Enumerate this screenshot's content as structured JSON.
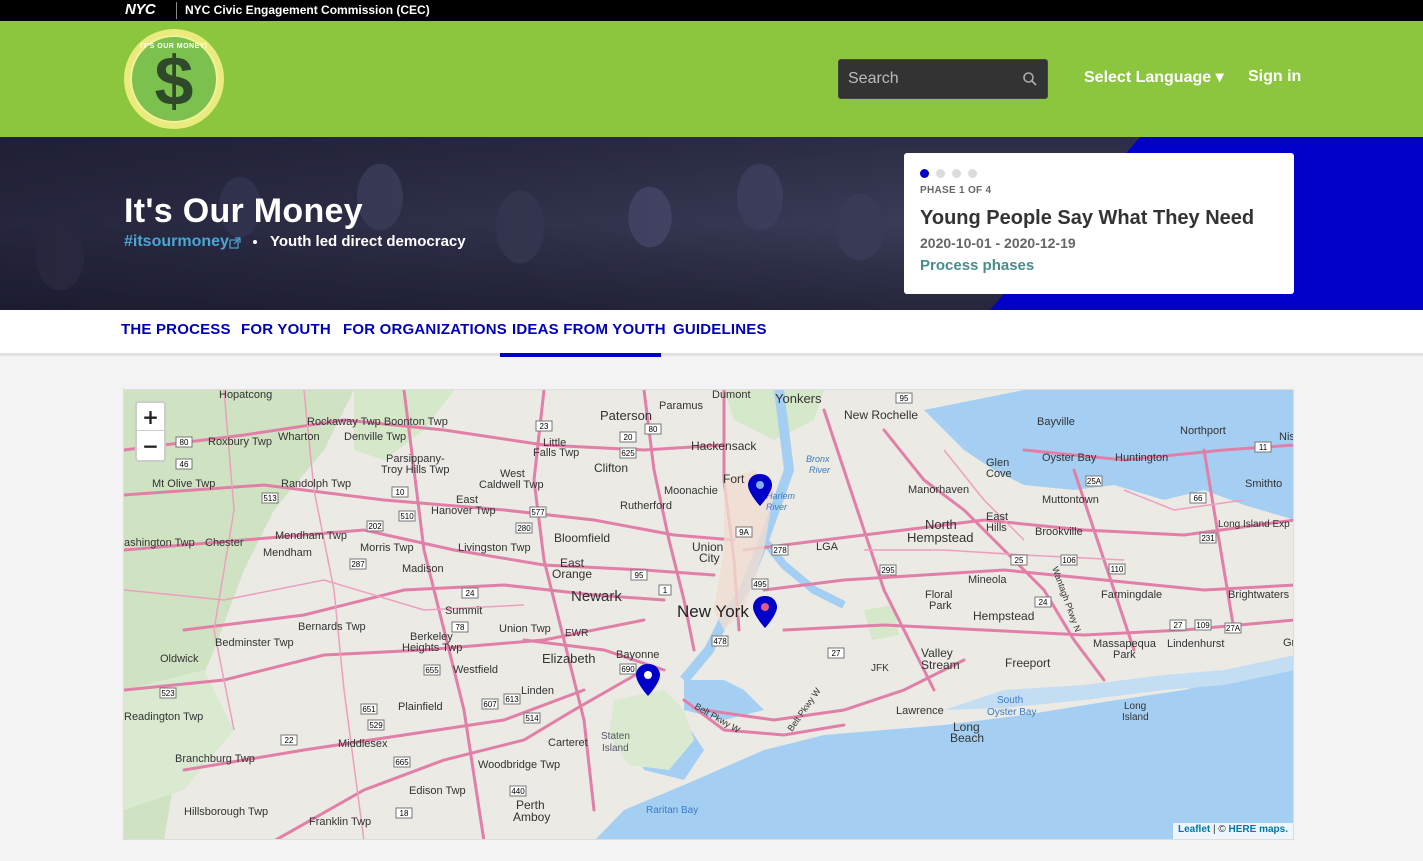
{
  "nyc_bar": {
    "logo_text": "NYC",
    "agency": "NYC Civic Engagement Commission (CEC)"
  },
  "header": {
    "logo_ring_text": "IT'S OUR MONEY!",
    "logo_symbol": "$",
    "search_placeholder": "Search",
    "language_label": "Select Language ▾",
    "signin_label": "Sign in"
  },
  "hero": {
    "title": "It's Our Money",
    "handle": "#itsourmoney",
    "slogan": "Youth led direct democracy",
    "phase": {
      "label": "PHASE 1 OF 4",
      "name": "Young People Say What They Need",
      "dates": "2020-10-01 - 2020-12-19",
      "link": "Process phases",
      "total": 4,
      "current": 1
    }
  },
  "nav": {
    "tabs": [
      {
        "label": "THE PROCESS"
      },
      {
        "label": "FOR YOUTH"
      },
      {
        "label": "FOR ORGANIZATIONS"
      },
      {
        "label": "IDEAS FROM YOUTH",
        "active": true
      },
      {
        "label": "GUIDELINES"
      }
    ]
  },
  "map": {
    "zoom_in": "+",
    "zoom_out": "−",
    "attribution_leaflet": "Leaflet",
    "attribution_sep": " | © ",
    "attribution_provider": "HERE maps.",
    "marker_count": 3,
    "labels": {
      "hopatcong": "Hopatcong",
      "rockaway": "Rockaway Twp Boonton Twp",
      "roxbury": "Roxbury Twp",
      "wharton": "Wharton",
      "denville": "Denville Twp",
      "parsippany": "Parsippany-",
      "troyhills": "Troy Hills Twp",
      "mtolive": "Mt Olive Twp",
      "randolph": "Randolph Twp",
      "eastHanover": "East",
      "eastHanover2": "Hanover Twp",
      "westCaldwell": "West",
      "westCaldwell2": "Caldwell Twp",
      "paterson": "Paterson",
      "littleFalls": "Little",
      "littleFalls2": "Falls Twp",
      "clifton": "Clifton",
      "paramus": "Paramus",
      "dumont": "Dumont",
      "hackensack": "Hackensack",
      "yonkers": "Yonkers",
      "newRochelle": "New Rochelle",
      "bayville": "Bayville",
      "northport": "Northport",
      "oysterBay": "Oyster Bay",
      "huntington": "Huntington",
      "glenCove": "Glen",
      "glenCove2": "Cove",
      "smithtown": "Smithto",
      "manorhaven": "Manorhaven",
      "muttontown": "Muttontown",
      "fort": "Fort",
      "moonachie": "Moonachie",
      "rutherford": "Rutherford",
      "bronxRiver": "Bronx",
      "bronxRiver2": "River",
      "harlemRiver": "Harlem",
      "harlemRiver2": "River",
      "northHempstead": "North",
      "northHempstead2": "Hempstead",
      "eastHills": "East",
      "eastHills2": "Hills",
      "brookville": "Brookville",
      "longIslandExp": "Long Island Exp",
      "washington": "ashington Twp",
      "chester": "Chester",
      "mendhamTwp": "Mendham Twp",
      "mendham": "Mendham",
      "morris": "Morris Twp",
      "livingston": "Livingston Twp",
      "bloomfield": "Bloomfield",
      "union": "Union",
      "city": "City",
      "lga": "LGA",
      "madison": "Madison",
      "eastOrange": "East",
      "eastOrange2": "Orange",
      "newark": "Newark",
      "newYork": "New York",
      "mineola": "Mineola",
      "farmingdale": "Farmingdale",
      "brightwaters": "Brightwaters",
      "summit": "Summit",
      "floralPark": "Floral",
      "floralPark2": "Park",
      "hempstead": "Hempstead",
      "bernards": "Bernards Twp",
      "berkeley": "Berkeley",
      "berkeley2": "Heights Twp",
      "unionTwp": "Union Twp",
      "ewr": "EWR",
      "bedminster": "Bedminster Twp",
      "massapequa": "Massapequa",
      "lindenhurst": "Lindenhurst",
      "park": "Park",
      "oldwick": "Oldwick",
      "westfield": "Westfield",
      "elizabeth": "Elizabeth",
      "bayonne": "Bayonne",
      "valleyStream": "Valley",
      "valleyStream2": "Stream",
      "freeport": "Freeport",
      "jfk": "JFK",
      "linden": "Linden",
      "plainfield": "Plainfield",
      "southOysterBay": "South",
      "southOysterBay2": "Oyster Bay",
      "lawrence": "Lawrence",
      "longBeach": "Long",
      "longBeach2": "Beach",
      "longIsland": "Long",
      "longIsland2": "Island",
      "readington": "Readington Twp",
      "middlesex": "Middlesex",
      "carteret": "Carteret",
      "statenIsland": "Staten",
      "statenIsland2": "Island",
      "branchburg": "Branchburg Twp",
      "woodbridge": "Woodbridge Twp",
      "edison": "Edison Twp",
      "perthAmboy": "Perth",
      "perthAmboy2": "Amboy",
      "raritanBay": "Raritan Bay",
      "hillsborough": "Hillsborough Twp",
      "franklin": "Franklin Twp",
      "beltPkwy": "Belt Pkwy W",
      "beltPkwy2": "Belt Pkwy W",
      "wantagh": "Wantagh Pkwy N",
      "nis": "Nis",
      "gr": "Gr"
    }
  },
  "colors": {
    "nyc_bar": "#000000",
    "header_green": "#8cc63f",
    "accent_blue": "#0000c8",
    "nav_text": "#0000b4",
    "handle": "#4ba6d3",
    "phase_link": "#4a8c8c",
    "water": "#a5cff2",
    "land": "#ebeae4",
    "green_land": "#cfe3c2",
    "road": "#e27fa8",
    "marker": "#0000c8"
  }
}
